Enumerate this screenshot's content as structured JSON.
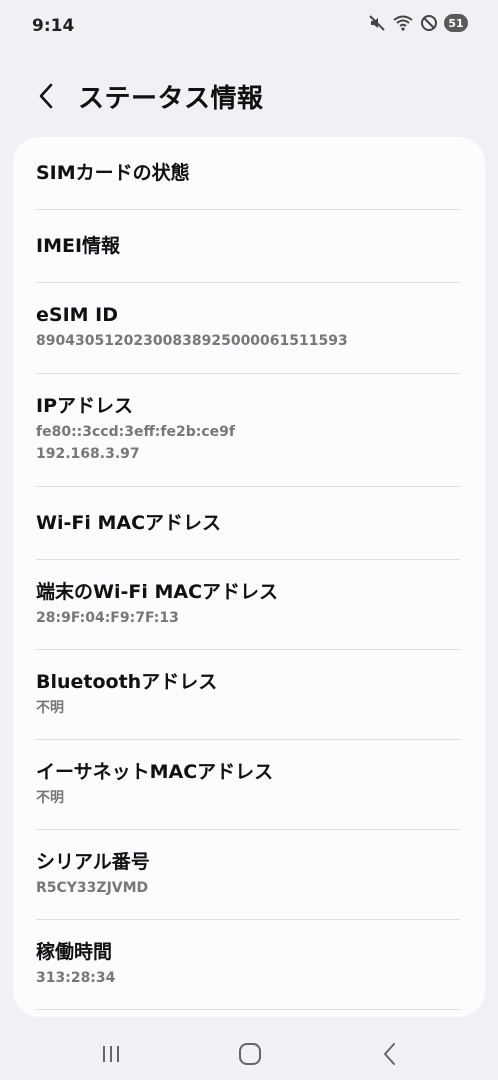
{
  "status": {
    "time": "9:14",
    "battery": "51"
  },
  "header": {
    "title": "ステータス情報"
  },
  "items": [
    {
      "title": "SIMカードの状態",
      "sub": ""
    },
    {
      "title": "IMEI情報",
      "sub": ""
    },
    {
      "title": "eSIM ID",
      "sub": "89043051202300838925000061511593"
    },
    {
      "title": "IPアドレス",
      "sub": "fe80::3ccd:3eff:fe2b:ce9f",
      "sub2": "192.168.3.97"
    },
    {
      "title": "Wi-Fi MACアドレス",
      "sub": ""
    },
    {
      "title": "端末のWi-Fi MACアドレス",
      "sub": "28:9F:04:F9:7F:13"
    },
    {
      "title": "Bluetoothアドレス",
      "sub": "不明"
    },
    {
      "title": "イーサネットMACアドレス",
      "sub": "不明"
    },
    {
      "title": "シリアル番号",
      "sub": "R5CY33ZJVMD"
    },
    {
      "title": "稼働時間",
      "sub": "313:28:34"
    }
  ]
}
